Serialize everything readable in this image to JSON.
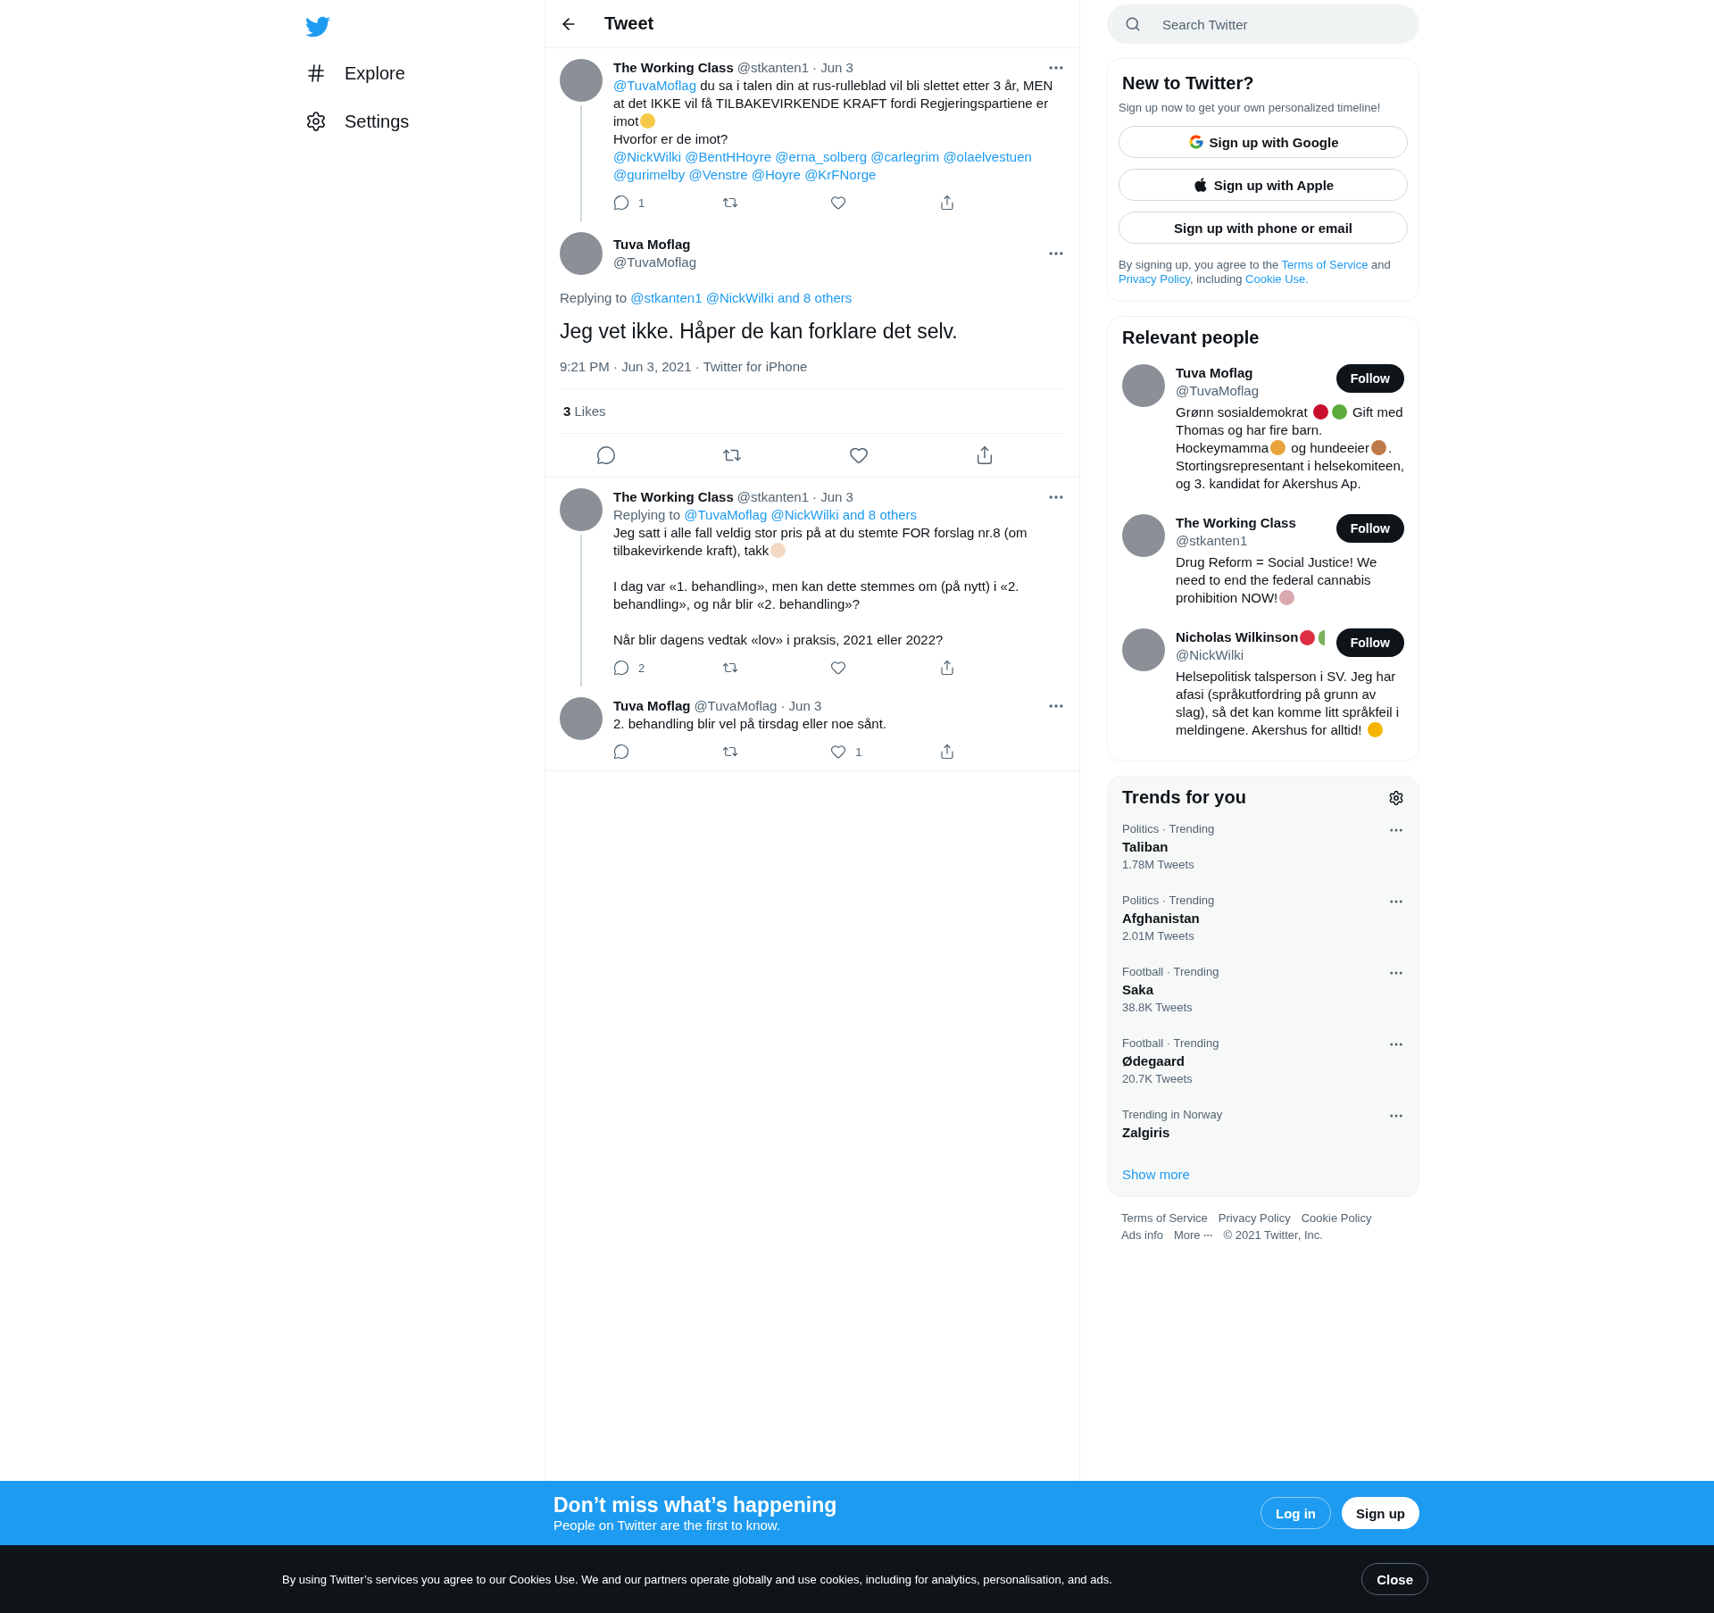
{
  "nav": {
    "items": [
      {
        "kind": "explore",
        "label": "Explore"
      },
      {
        "kind": "settings",
        "label": "Settings"
      }
    ]
  },
  "header": {
    "title": "Tweet"
  },
  "thread": [
    {
      "kind": "reply",
      "name": "The Working Class",
      "handle": "@stkanten1",
      "date": "· Jun 3",
      "thread_line": true,
      "paragraphs": [
        [
          {
            "kind": "link",
            "text": "@TuvaMoflag"
          },
          {
            "kind": "text",
            "text": " du sa i talen din at rus-rulleblad vil bli slettet etter 3 år, MEN at det IKKE vil få TILBAKEVIRKENDE KRAFT fordi Regjeringspartiene er imot"
          },
          {
            "kind": "emoji",
            "color": "#f7c948"
          }
        ],
        [
          {
            "kind": "text",
            "text": "Hvorfor er de imot?"
          }
        ],
        [
          {
            "kind": "link",
            "text": "@NickWilki"
          },
          {
            "kind": "link",
            "text": "@BentHHoyre"
          },
          {
            "kind": "link",
            "text": "@erna_solberg"
          },
          {
            "kind": "link",
            "text": "@carlegrim"
          },
          {
            "kind": "link",
            "text": "@olaelvestuen"
          },
          {
            "kind": "link",
            "text": "@gurimelby"
          },
          {
            "kind": "link",
            "text": "@Venstre"
          },
          {
            "kind": "link",
            "text": "@Hoyre"
          },
          {
            "kind": "link",
            "text": "@KrFNorge"
          }
        ]
      ],
      "actions": [
        {
          "kind": "reply",
          "count": "1"
        },
        {
          "kind": "retweet"
        },
        {
          "kind": "like"
        },
        {
          "kind": "share"
        }
      ]
    },
    {
      "kind": "focused",
      "name": "Tuva Moflag",
      "handle": "@TuvaMoflag",
      "replying_to": {
        "label": "Replying to",
        "links": [
          "@stkanten1",
          "@NickWilki",
          "and 8 others"
        ]
      },
      "text": "Jeg vet ikke. Håper de kan forklare det selv.",
      "meta": "9:21 PM · Jun 3, 2021 · Twitter for iPhone",
      "likes_count": "3",
      "likes_label": "Likes",
      "actions": [
        {
          "kind": "reply"
        },
        {
          "kind": "retweet"
        },
        {
          "kind": "like"
        },
        {
          "kind": "share"
        }
      ]
    },
    {
      "kind": "reply",
      "name": "The Working Class",
      "handle": "@stkanten1",
      "date": "· Jun 3",
      "thread_line": true,
      "replying_to": {
        "label": "Replying to",
        "links": [
          "@TuvaMoflag",
          "@NickWilki",
          "and 8 others"
        ]
      },
      "paragraphs": [
        [
          {
            "kind": "text",
            "text": "Jeg satt i alle fall veldig stor pris på at du stemte FOR forslag nr.8 (om tilbakevirkende kraft), takk"
          },
          {
            "kind": "emoji",
            "color": "#f3d9c4"
          }
        ],
        [
          {
            "kind": "text",
            "text": "I dag var «1. behandling», men kan dette stemmes om (på nytt) i «2. behandling», og når blir «2. behandling»?"
          }
        ],
        [
          {
            "kind": "text",
            "text": "Når blir dagens vedtak «lov» i praksis, 2021 eller 2022?"
          }
        ]
      ],
      "actions": [
        {
          "kind": "reply",
          "count": "2"
        },
        {
          "kind": "retweet"
        },
        {
          "kind": "like"
        },
        {
          "kind": "share"
        }
      ]
    },
    {
      "kind": "reply",
      "name": "Tuva Moflag",
      "handle": "@TuvaMoflag",
      "date": "· Jun 3",
      "thread_line": false,
      "paragraphs": [
        [
          {
            "kind": "text",
            "text": "2. behandling blir vel på tirsdag eller noe sånt."
          }
        ]
      ],
      "actions": [
        {
          "kind": "reply"
        },
        {
          "kind": "retweet"
        },
        {
          "kind": "like",
          "count": "1"
        },
        {
          "kind": "share"
        }
      ]
    }
  ],
  "search": {
    "placeholder": "Search Twitter"
  },
  "signup": {
    "title": "New to Twitter?",
    "subtitle": "Sign up now to get your own personalized timeline!",
    "buttons": [
      {
        "kind": "google",
        "label": "Sign up with Google"
      },
      {
        "kind": "apple",
        "label": "Sign up with Apple"
      },
      {
        "kind": "plain",
        "label": "Sign up with phone or email"
      }
    ],
    "legal": [
      {
        "kind": "text",
        "text": "By signing up, you agree to the "
      },
      {
        "kind": "link",
        "text": "Terms of Service"
      },
      {
        "kind": "text",
        "text": " and "
      },
      {
        "kind": "link",
        "text": "Privacy Policy"
      },
      {
        "kind": "text",
        "text": ", including "
      },
      {
        "kind": "link",
        "text": "Cookie Use."
      }
    ]
  },
  "people": {
    "title": "Relevant people",
    "items": [
      {
        "name": "Tuva Moflag",
        "handle": "@TuvaMoflag",
        "button": "Follow",
        "bio": [
          {
            "kind": "text",
            "text": "Grønn sosialdemokrat "
          },
          {
            "kind": "emoji",
            "color": "#c8102e"
          },
          {
            "kind": "emoji",
            "color": "#5dab3d"
          },
          {
            "kind": "text",
            "text": " Gift med Thomas og har fire barn. Hockeymamma"
          },
          {
            "kind": "emoji",
            "color": "#e8a33d"
          },
          {
            "kind": "text",
            "text": " og hundeeier"
          },
          {
            "kind": "emoji",
            "color": "#c07a4a"
          },
          {
            "kind": "text",
            "text": ". Stortingsrepresentant i helsekomiteen, og 3. kandidat for Akershus Ap."
          }
        ]
      },
      {
        "name": "The Working Class",
        "handle": "@stkanten1",
        "button": "Follow",
        "bio": [
          {
            "kind": "text",
            "text": "Drug Reform = Social Justice! We need to end the federal cannabis prohibition NOW!"
          },
          {
            "kind": "emoji",
            "color": "#d9a9b0"
          }
        ]
      },
      {
        "name": "Nicholas Wilkinson",
        "name_emojis": [
          {
            "color": "#dd2e44",
            "cut": false
          },
          {
            "color": "#78b159",
            "cut": true
          }
        ],
        "handle": "@NickWilki",
        "button": "Follow",
        "bio": [
          {
            "kind": "text",
            "text": "Helsepolitisk talsperson i SV. Jeg har afasi (språkutfordring på grunn av slag), så det kan komme litt språkfeil i meldingene. Akershus for alltid! "
          },
          {
            "kind": "emoji",
            "color": "#f4b400"
          }
        ]
      }
    ]
  },
  "trends": {
    "title": "Trends for you",
    "items": [
      {
        "context": "Politics · Trending",
        "topic": "Taliban",
        "count": "1.78M Tweets"
      },
      {
        "context": "Politics · Trending",
        "topic": "Afghanistan",
        "count": "2.01M Tweets"
      },
      {
        "context": "Football · Trending",
        "topic": "Saka",
        "count": "38.8K Tweets"
      },
      {
        "context": "Football · Trending",
        "topic": "Ødegaard",
        "count": "20.7K Tweets"
      },
      {
        "context": "Trending in Norway",
        "topic": "Zalgiris"
      }
    ],
    "show_more": "Show more"
  },
  "footer": {
    "links": [
      {
        "kind": "link",
        "text": "Terms of Service"
      },
      {
        "kind": "link",
        "text": "Privacy Policy"
      },
      {
        "kind": "link",
        "text": "Cookie Policy"
      },
      {
        "kind": "link",
        "text": "Ads info"
      },
      {
        "kind": "more",
        "text": "More"
      },
      {
        "kind": "text",
        "text": "© 2021 Twitter, Inc."
      }
    ]
  },
  "banner": {
    "title": "Don’t miss what’s happening",
    "subtitle": "People on Twitter are the first to know.",
    "login": "Log in",
    "signup": "Sign up"
  },
  "cookies": {
    "text": "By using Twitter’s services you agree to our Cookies Use. We and our partners operate globally and use cookies, including for analytics, personalisation, and ads.",
    "close": "Close"
  }
}
